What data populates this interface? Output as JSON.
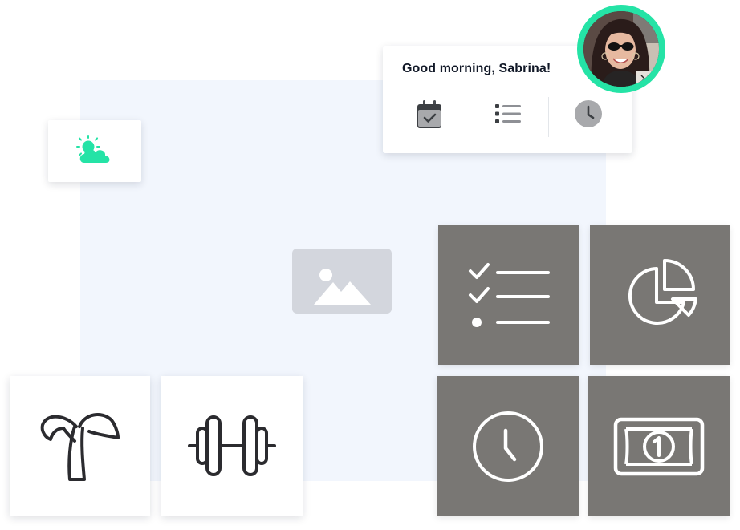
{
  "greeting": {
    "text": "Good morning, Sabrina!"
  },
  "greeting_actions": [
    {
      "icon": "calendar-check-icon"
    },
    {
      "icon": "list-icon"
    },
    {
      "icon": "clock-icon"
    }
  ],
  "widgets": {
    "weather_icon": "partly-cloudy-icon",
    "placeholder_icon": "image-placeholder-icon"
  },
  "tiles": [
    {
      "icon": "checklist-icon",
      "style": "dark"
    },
    {
      "icon": "pie-chart-icon",
      "style": "dark"
    },
    {
      "icon": "clock-icon",
      "style": "dark"
    },
    {
      "icon": "banknote-icon",
      "style": "dark"
    },
    {
      "icon": "palm-tree-icon",
      "style": "light"
    },
    {
      "icon": "dumbbell-icon",
      "style": "light"
    }
  ],
  "colors": {
    "accent": "#25e3a6",
    "panel_background": "#f2f6fd",
    "tile_dark": "#797774",
    "tile_light": "#ffffff",
    "icon_dark": "#2b2b2f"
  }
}
